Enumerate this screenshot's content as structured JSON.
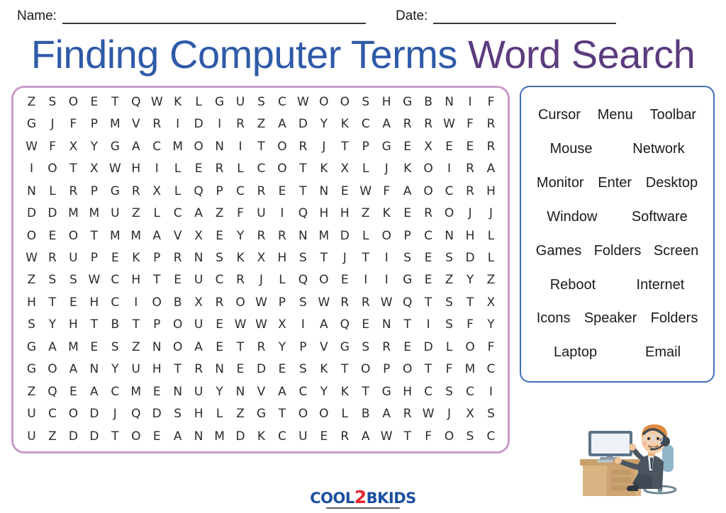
{
  "header": {
    "name_label": "Name:",
    "date_label": "Date:"
  },
  "title": {
    "main": "Finding Computer Terms",
    "sub": "Word Search"
  },
  "colors": {
    "title_main": "#2f5aa8",
    "title_sub": "#5c3b7e",
    "puzzle_border": "#c89bc8",
    "wordlist_border": "#3f6fb5",
    "logo_blue": "#1a4fa0",
    "logo_red": "#e8262f"
  },
  "puzzle": {
    "rows": 16,
    "cols": 23,
    "grid": [
      [
        "Z",
        "S",
        "O",
        "E",
        "T",
        "Q",
        "W",
        "K",
        "L",
        "G",
        "U",
        "S",
        "C",
        "W",
        "O",
        "O",
        "S",
        "H",
        "G",
        "B",
        "N",
        "I",
        "F"
      ],
      [
        "G",
        "J",
        "F",
        "P",
        "M",
        "V",
        "R",
        "I",
        "D",
        "I",
        "R",
        "Z",
        "A",
        "D",
        "Y",
        "K",
        "C",
        "A",
        "R",
        "R",
        "W",
        "F",
        "R"
      ],
      [
        "W",
        "F",
        "X",
        "Y",
        "G",
        "A",
        "C",
        "M",
        "O",
        "N",
        "I",
        "T",
        "O",
        "R",
        "J",
        "T",
        "P",
        "G",
        "E",
        "X",
        "E",
        "E",
        "R"
      ],
      [
        "I",
        "O",
        "T",
        "X",
        "W",
        "H",
        "I",
        "L",
        "E",
        "R",
        "L",
        "C",
        "O",
        "T",
        "K",
        "X",
        "L",
        "J",
        "K",
        "O",
        "I",
        "R",
        "A"
      ],
      [
        "N",
        "L",
        "R",
        "P",
        "G",
        "R",
        "X",
        "L",
        "Q",
        "P",
        "C",
        "R",
        "E",
        "T",
        "N",
        "E",
        "W",
        "F",
        "A",
        "O",
        "C",
        "R",
        "H"
      ],
      [
        "D",
        "D",
        "M",
        "M",
        "U",
        "Z",
        "L",
        "C",
        "A",
        "Z",
        "F",
        "U",
        "I",
        "Q",
        "H",
        "H",
        "Z",
        "K",
        "E",
        "R",
        "O",
        "J",
        "J"
      ],
      [
        "O",
        "E",
        "O",
        "T",
        "M",
        "M",
        "A",
        "V",
        "X",
        "E",
        "Y",
        "R",
        "R",
        "N",
        "M",
        "D",
        "L",
        "O",
        "P",
        "C",
        "N",
        "H",
        "L"
      ],
      [
        "W",
        "R",
        "U",
        "P",
        "E",
        "K",
        "P",
        "R",
        "N",
        "S",
        "K",
        "X",
        "H",
        "S",
        "T",
        "J",
        "T",
        "I",
        "S",
        "E",
        "S",
        "D",
        "L"
      ],
      [
        "Z",
        "S",
        "S",
        "W",
        "C",
        "H",
        "T",
        "E",
        "U",
        "C",
        "R",
        "J",
        "L",
        "Q",
        "O",
        "E",
        "I",
        "I",
        "G",
        "E",
        "Z",
        "Y",
        "Z"
      ],
      [
        "H",
        "T",
        "E",
        "H",
        "C",
        "I",
        "O",
        "B",
        "X",
        "R",
        "O",
        "W",
        "P",
        "S",
        "W",
        "R",
        "R",
        "W",
        "Q",
        "T",
        "S",
        "T",
        "X"
      ],
      [
        "S",
        "Y",
        "H",
        "T",
        "B",
        "T",
        "P",
        "O",
        "U",
        "E",
        "W",
        "W",
        "X",
        "I",
        "A",
        "Q",
        "E",
        "N",
        "T",
        "I",
        "S",
        "F",
        "Y"
      ],
      [
        "G",
        "A",
        "M",
        "E",
        "S",
        "Z",
        "N",
        "O",
        "A",
        "E",
        "T",
        "R",
        "Y",
        "P",
        "V",
        "G",
        "S",
        "R",
        "E",
        "D",
        "L",
        "O",
        "F"
      ],
      [
        "G",
        "O",
        "A",
        "N",
        "Y",
        "U",
        "H",
        "T",
        "R",
        "N",
        "E",
        "D",
        "E",
        "S",
        "K",
        "T",
        "O",
        "P",
        "O",
        "T",
        "F",
        "M",
        "C"
      ],
      [
        "Z",
        "Q",
        "E",
        "A",
        "C",
        "M",
        "E",
        "N",
        "U",
        "Y",
        "N",
        "V",
        "A",
        "C",
        "Y",
        "K",
        "T",
        "G",
        "H",
        "C",
        "S",
        "C",
        "I"
      ],
      [
        "U",
        "C",
        "O",
        "D",
        "J",
        "Q",
        "D",
        "S",
        "H",
        "L",
        "Z",
        "G",
        "T",
        "O",
        "O",
        "L",
        "B",
        "A",
        "R",
        "W",
        "J",
        "X",
        "S"
      ],
      [
        "U",
        "Z",
        "D",
        "D",
        "T",
        "O",
        "E",
        "A",
        "N",
        "M",
        "D",
        "K",
        "C",
        "U",
        "E",
        "R",
        "A",
        "W",
        "T",
        "F",
        "O",
        "S",
        "C"
      ]
    ]
  },
  "wordlist": {
    "rows": [
      [
        "Cursor",
        "Menu",
        "Toolbar"
      ],
      [
        "Mouse",
        "Network"
      ],
      [
        "Monitor",
        "Enter",
        "Desktop"
      ],
      [
        "Window",
        "Software"
      ],
      [
        "Games",
        "Folders",
        "Screen"
      ],
      [
        "Reboot",
        "Internet"
      ],
      [
        "Icons",
        "Speaker",
        "Folders"
      ],
      [
        "Laptop",
        "Email"
      ]
    ]
  },
  "footer": {
    "logo_part1": "COOL",
    "logo_part2": "2",
    "logo_part3": "BKIDS"
  }
}
